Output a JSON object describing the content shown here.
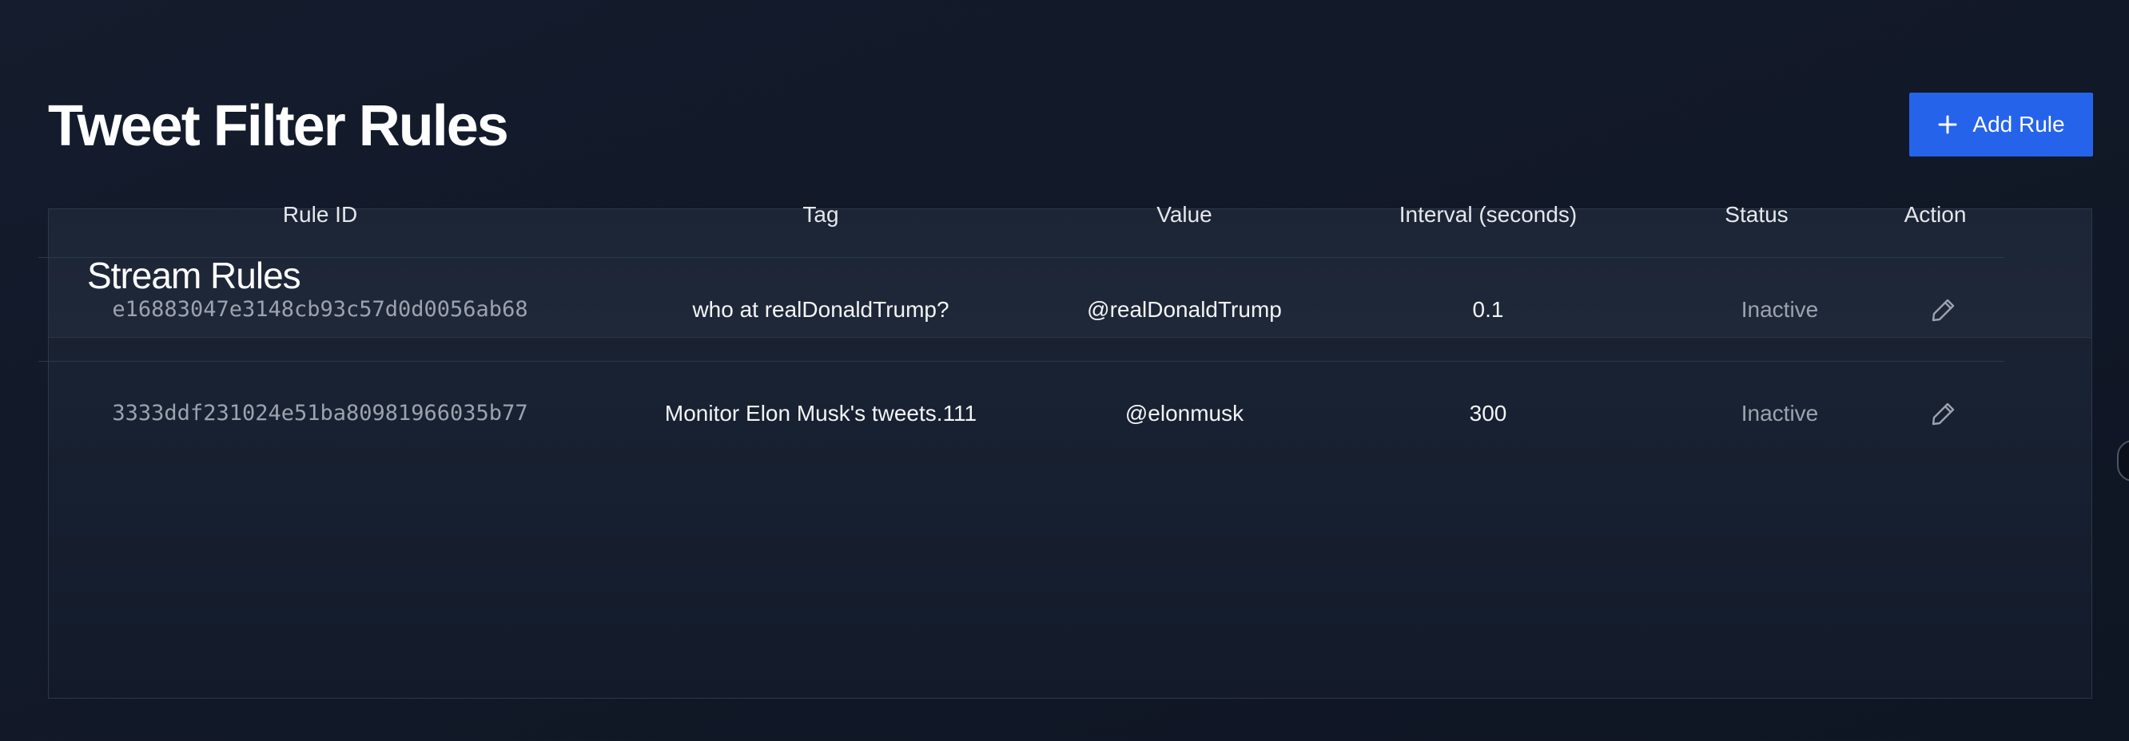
{
  "header": {
    "title": "Tweet Filter Rules",
    "add_button_label": "Add Rule"
  },
  "card": {
    "title": "Stream Rules"
  },
  "table": {
    "columns": [
      "Rule ID",
      "Tag",
      "Value",
      "Interval (seconds)",
      "Status",
      "Action"
    ],
    "rows": [
      {
        "rule_id": "e16883047e3148cb93c57d0d0056ab68",
        "tag": "who at realDonaldTrump?",
        "value": "@realDonaldTrump",
        "interval": "0.1",
        "status": "Inactive",
        "action_icon": "pencil-icon"
      },
      {
        "rule_id": "3333ddf231024e51ba80981966035b77",
        "tag": "Monitor Elon Musk's tweets.111",
        "value": "@elonmusk",
        "interval": "300",
        "status": "Inactive",
        "action_icon": "pencil-icon"
      }
    ]
  },
  "colors": {
    "background": "#111827",
    "accent": "#2563eb",
    "muted_text": "#9ca3af",
    "border": "#2d3748"
  }
}
